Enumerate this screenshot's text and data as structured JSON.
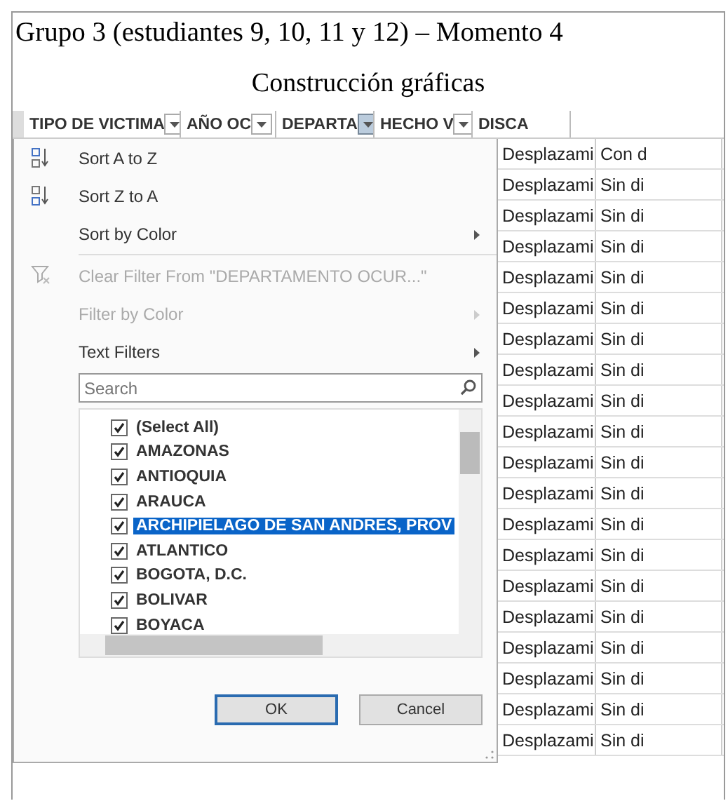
{
  "document": {
    "title": "Grupo 3 (estudiantes 9, 10, 11 y 12) – Momento 4",
    "subtitle": "Construcción gráficas"
  },
  "columns": [
    {
      "label": "TIPO DE VICTIMA",
      "filter_active": false
    },
    {
      "label": "AÑO OC",
      "filter_active": false
    },
    {
      "label": "DEPARTA",
      "filter_active": true
    },
    {
      "label": "HECHO V",
      "filter_active": false
    },
    {
      "label": "DISCA"
    }
  ],
  "menu": [
    {
      "kind": "sort_asc",
      "label": "Sort A to Z",
      "disabled": false,
      "submenu": false
    },
    {
      "kind": "sort_desc",
      "label": "Sort Z to A",
      "disabled": false,
      "submenu": false
    },
    {
      "kind": "item",
      "label": "Sort by Color",
      "disabled": false,
      "submenu": true
    },
    {
      "kind": "clear",
      "label": "Clear Filter From \"DEPARTAMENTO OCUR...\"",
      "disabled": true,
      "submenu": false
    },
    {
      "kind": "item",
      "label": "Filter by Color",
      "disabled": true,
      "submenu": true
    },
    {
      "kind": "item",
      "label": "Text Filters",
      "disabled": false,
      "submenu": true
    }
  ],
  "search": {
    "placeholder": "Search"
  },
  "values": [
    {
      "label": "(Select All)",
      "checked": true,
      "selected": false
    },
    {
      "label": "AMAZONAS",
      "checked": true,
      "selected": false
    },
    {
      "label": "ANTIOQUIA",
      "checked": true,
      "selected": false
    },
    {
      "label": "ARAUCA",
      "checked": true,
      "selected": false
    },
    {
      "label": "ARCHIPIELAGO DE SAN ANDRES, PROV",
      "checked": true,
      "selected": true
    },
    {
      "label": "ATLANTICO",
      "checked": true,
      "selected": false
    },
    {
      "label": "BOGOTA, D.C.",
      "checked": true,
      "selected": false
    },
    {
      "label": "BOLIVAR",
      "checked": true,
      "selected": false
    },
    {
      "label": "BOYACA",
      "checked": true,
      "selected": false
    }
  ],
  "buttons": [
    {
      "label": "OK",
      "default": true
    },
    {
      "label": "Cancel",
      "default": false
    }
  ],
  "rows": [
    [
      "Desplazami",
      "Con d"
    ],
    [
      "Desplazami",
      "Sin di"
    ],
    [
      "Desplazami",
      "Sin di"
    ],
    [
      "Desplazami",
      "Sin di"
    ],
    [
      "Desplazami",
      "Sin di"
    ],
    [
      "Desplazami",
      "Sin di"
    ],
    [
      "Desplazami",
      "Sin di"
    ],
    [
      "Desplazami",
      "Sin di"
    ],
    [
      "Desplazami",
      "Sin di"
    ],
    [
      "Desplazami",
      "Sin di"
    ],
    [
      "Desplazami",
      "Sin di"
    ],
    [
      "Desplazami",
      "Sin di"
    ],
    [
      "Desplazami",
      "Sin di"
    ],
    [
      "Desplazami",
      "Sin di"
    ],
    [
      "Desplazami",
      "Sin di"
    ],
    [
      "Desplazami",
      "Sin di"
    ],
    [
      "Desplazami",
      "Sin di"
    ],
    [
      "Desplazami",
      "Sin di"
    ],
    [
      "Desplazami",
      "Sin di"
    ],
    [
      "Desplazami",
      "Sin di"
    ]
  ]
}
